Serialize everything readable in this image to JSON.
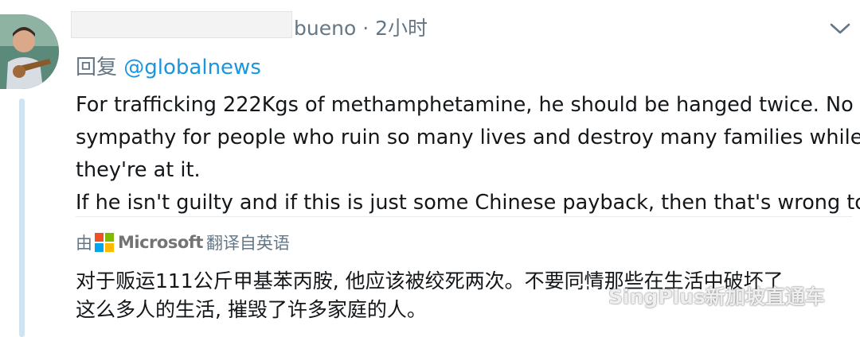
{
  "tweet": {
    "handle": "bueno",
    "separator": "·",
    "time": "2小时",
    "reply_label": "回复",
    "reply_mention": "@globalnews",
    "text_lines": [
      "For trafficking 222Kgs of methamphetamine, he should be hanged twice. No",
      "sympathy for people who ruin so many lives and destroy many families while",
      "they're at it.",
      "If he isn't guilty and if this is just some Chinese payback, then that's wrong too."
    ],
    "menu_icon": "chevron-down-icon",
    "avatar": "user-avatar-photo"
  },
  "translation": {
    "prefix": "由",
    "provider": "Microsoft",
    "suffix": "翻译自英语",
    "logo_colors": [
      "#f25022",
      "#7fba00",
      "#00a4ef",
      "#ffb900"
    ],
    "lines": [
      "对于贩运111公斤甲基苯丙胺, 他应该被绞死两次。不要同情那些在生活中破坏了",
      "这么多人的生活, 摧毁了许多家庭的人。"
    ]
  },
  "watermark": {
    "text": "SingPlus新加坡直通车",
    "icon": "wechat-icon"
  },
  "colors": {
    "secondary_text": "#657786",
    "link": "#1b95e0",
    "thread_line": "#cfe3f1"
  }
}
